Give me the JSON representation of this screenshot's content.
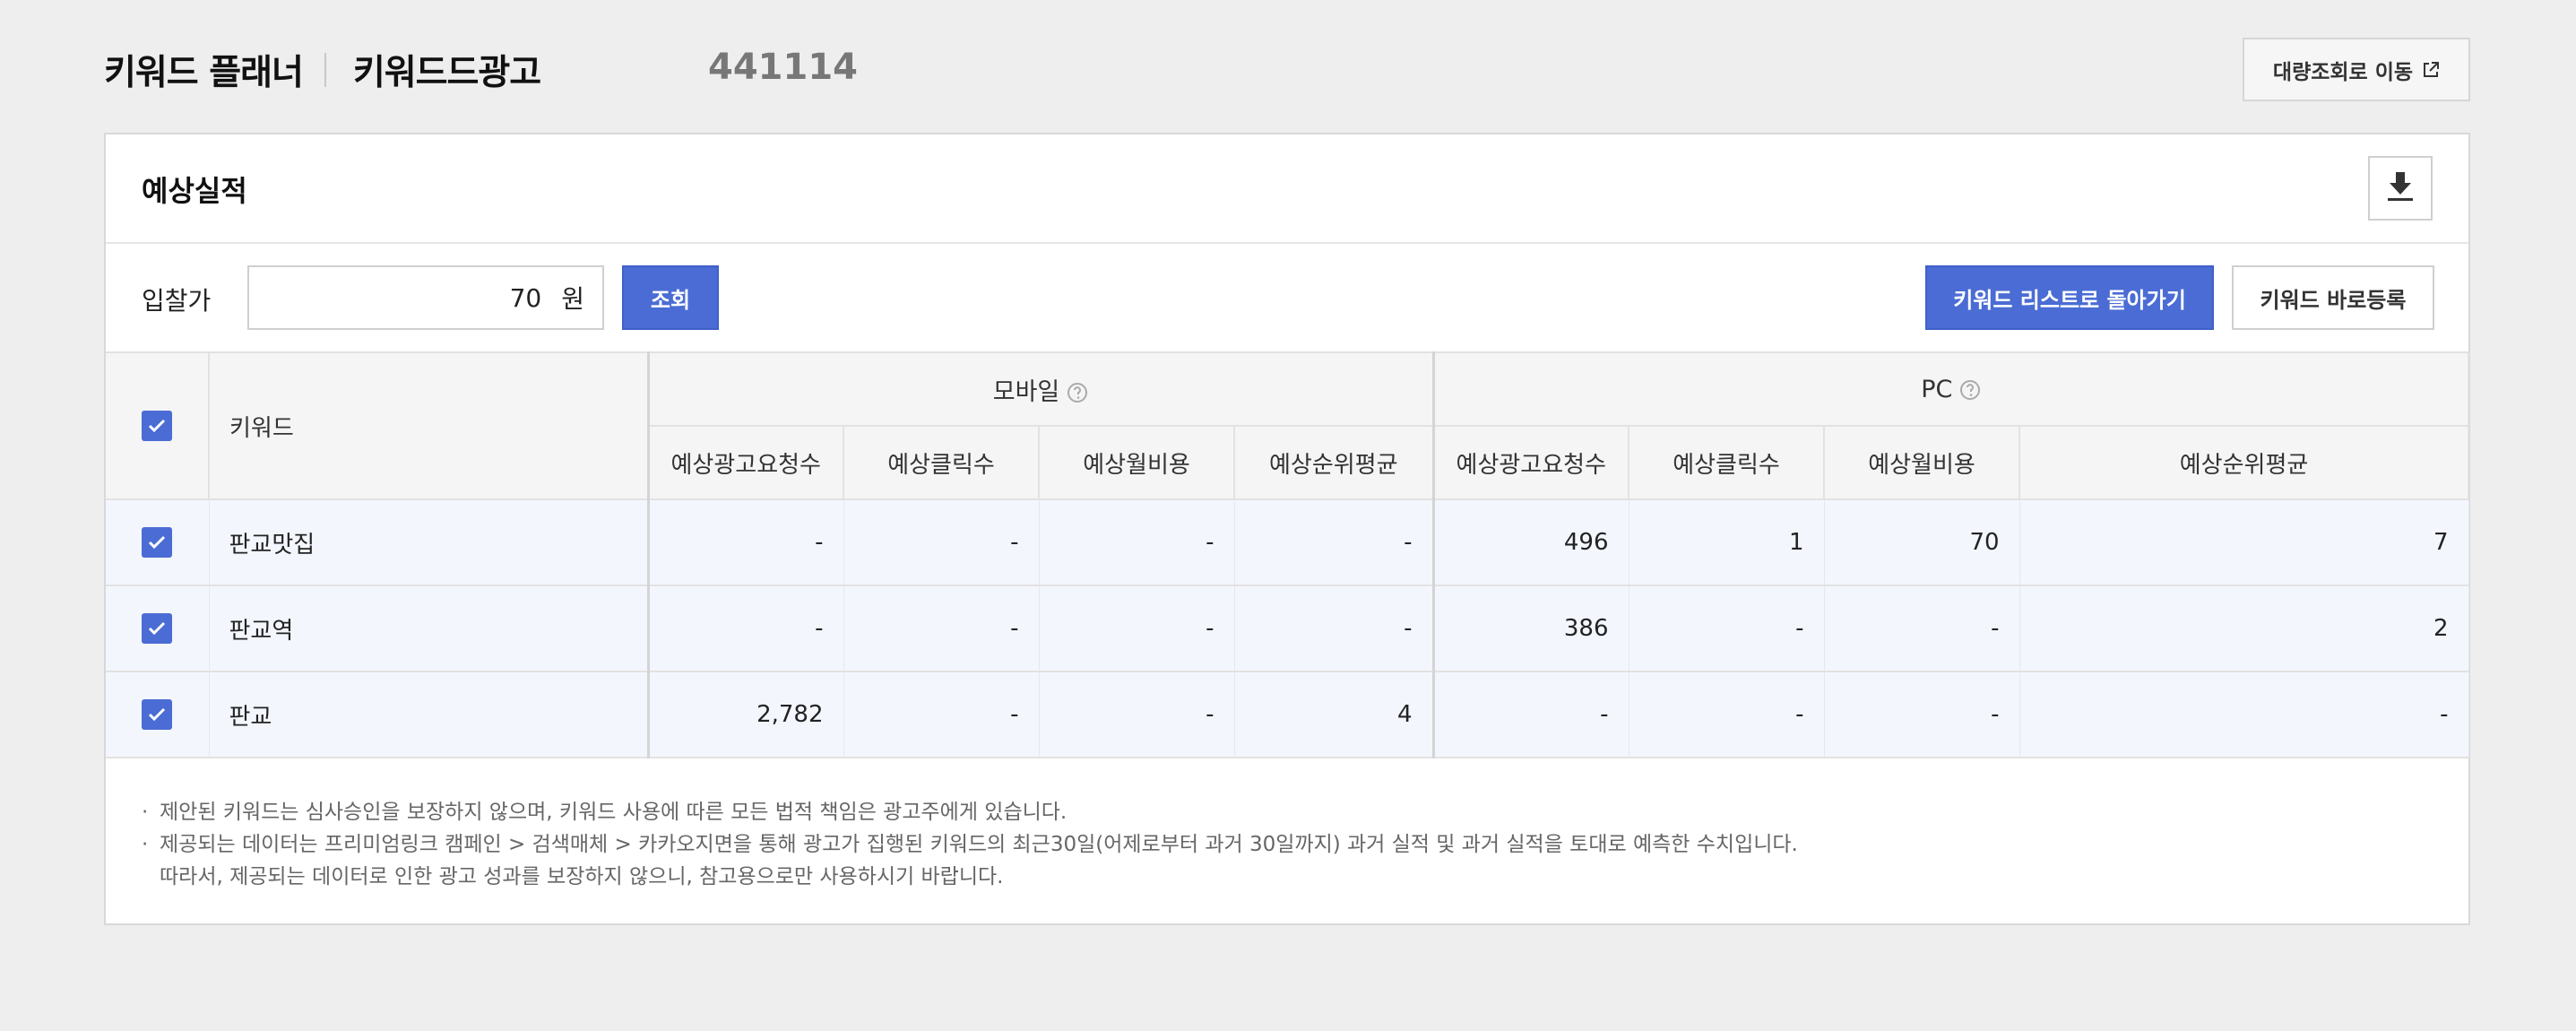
{
  "header": {
    "brand": "키워드 플래너",
    "section": "키워드드광고",
    "account_id": "441114",
    "bulk_button": "대량조회로 이동"
  },
  "card": {
    "title": "예상실적",
    "bid_label": "입찰가",
    "bid_value": "70",
    "bid_unit": "원",
    "query_button": "조회",
    "back_button": "키워드 리스트로 돌아가기",
    "register_button": "키워드 바로등록"
  },
  "table": {
    "keyword_header": "키워드",
    "mobile_group": "모바일",
    "pc_group": "PC",
    "columns": [
      "예상광고요청수",
      "예상클릭수",
      "예상월비용",
      "예상순위평균"
    ],
    "rows": [
      {
        "keyword": "판교맛집",
        "mobile": [
          "-",
          "-",
          "-",
          "-"
        ],
        "pc": [
          "496",
          "1",
          "70",
          "7"
        ]
      },
      {
        "keyword": "판교역",
        "mobile": [
          "-",
          "-",
          "-",
          "-"
        ],
        "pc": [
          "386",
          "-",
          "-",
          "2"
        ]
      },
      {
        "keyword": "판교",
        "mobile": [
          "2,782",
          "-",
          "-",
          "4"
        ],
        "pc": [
          "-",
          "-",
          "-",
          "-"
        ]
      }
    ]
  },
  "notes": {
    "line1": "제안된 키워드는 심사승인을 보장하지 않으며, 키워드 사용에 따른 모든 법적 책임은 광고주에게 있습니다.",
    "line2": "제공되는 데이터는 프리미엄링크 캠페인 > 검색매체 > 카카오지면을 통해 광고가 집행된 키워드의 최근30일(어제로부터 과거 30일까지) 과거 실적 및 과거 실적을 토대로 예측한 수치입니다.",
    "line3": "따라서, 제공되는 데이터로 인한 광고 성과를 보장하지 않으니, 참고용으로만 사용하시기 바랍니다."
  },
  "colors": {
    "accent": "#4a6cd4",
    "row_bg": "#f3f6fd",
    "page_bg": "#eeeeee"
  }
}
